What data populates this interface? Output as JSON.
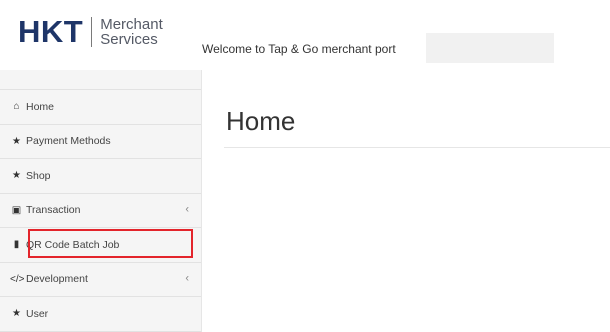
{
  "header": {
    "logo": {
      "brand": "HKT",
      "line1": "Merchant",
      "line2": "Services"
    },
    "welcome_text": "Welcome to Tap & Go merchant port"
  },
  "sidebar": {
    "items": [
      {
        "label": "Home",
        "icon": "home-icon"
      },
      {
        "label": "Payment Methods",
        "icon": "star-icon"
      },
      {
        "label": "Shop",
        "icon": "star-icon"
      },
      {
        "label": "Transaction",
        "icon": "card-icon",
        "has_submenu": true
      },
      {
        "label": "QR Code Batch Job",
        "icon": "file-icon",
        "highlighted": true
      },
      {
        "label": "Development",
        "icon": "code-icon",
        "has_submenu": true
      },
      {
        "label": "User",
        "icon": "star-icon"
      }
    ],
    "chevron": "‹"
  },
  "main": {
    "title": "Home"
  },
  "colors": {
    "brand": "#1e3568",
    "highlight": "#e3242b",
    "sidebar_bg": "#f5f5f5"
  }
}
